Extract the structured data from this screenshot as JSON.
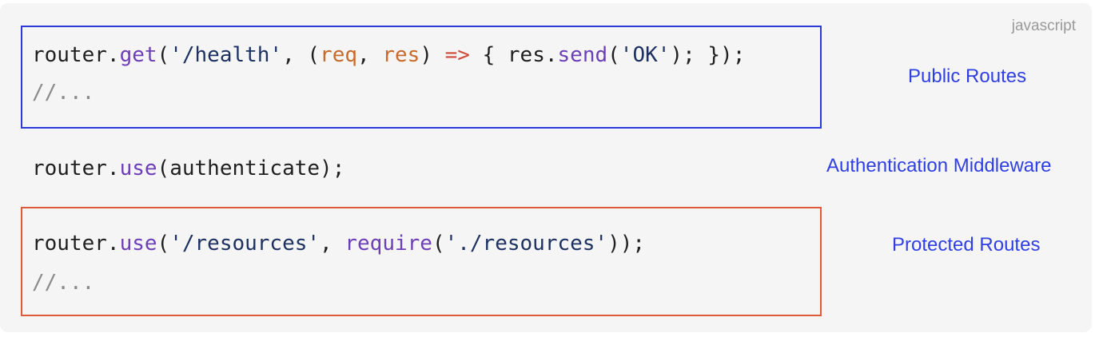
{
  "language_label": "javascript",
  "code_lines": [
    "router.get('/health', (req, res) => { res.send('OK'); });",
    "//...",
    "router.use(authenticate);",
    "router.use('/resources', require('./resources'));",
    "//..."
  ],
  "tokens": {
    "l1_router": "router.",
    "l1_get": "get",
    "l1_open": "(",
    "l1_path": "'/health'",
    "l1_comma": ", (",
    "l1_req": "req",
    "l1_sep": ", ",
    "l1_res": "res",
    "l1_close": ") ",
    "l1_arrow": "=>",
    "l1_body_open": " { res.",
    "l1_send": "send",
    "l1_paren": "(",
    "l1_ok": "'OK'",
    "l1_end": "); });",
    "l2_comment": "//...",
    "l3_router": "router.",
    "l3_use": "use",
    "l3_rest": "(authenticate);",
    "l4_router": "router.",
    "l4_use": "use",
    "l4_open": "(",
    "l4_path": "'/resources'",
    "l4_comma": ", ",
    "l4_require": "require",
    "l4_paren": "(",
    "l4_mod": "'./resources'",
    "l4_end": "));",
    "l5_comment": "//..."
  },
  "annotations": {
    "public": "Public Routes",
    "auth": "Authentication Middleware",
    "protected": "Protected Routes"
  },
  "colors": {
    "public_box": "#2b39d8",
    "protected_box": "#de5a3a",
    "annotation_text": "#2f3fe6"
  }
}
